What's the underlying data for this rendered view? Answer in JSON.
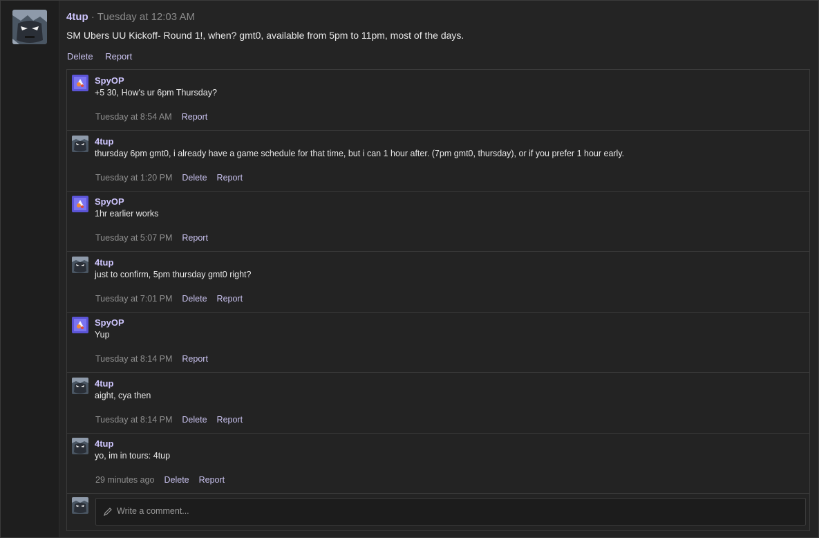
{
  "post": {
    "author": "4tup",
    "separator": "·",
    "time": "Tuesday at 12:03 AM",
    "body": "SM Ubers UU Kickoff- Round 1!, when? gmt0, available from 5pm to 11pm, most of the days.",
    "actions": {
      "delete": "Delete",
      "report": "Report"
    }
  },
  "comments": [
    {
      "author": "SpyOP",
      "text": "+5 30, How's ur 6pm Thursday?",
      "time": "Tuesday at 8:54 AM",
      "actions": [
        "Report"
      ],
      "avatar": "spyop-avatar"
    },
    {
      "author": "4tup",
      "text": "thursday 6pm gmt0, i already have a game schedule for that time, but i can 1 hour after. (7pm gmt0, thursday), or if you prefer 1 hour early.",
      "time": "Tuesday at 1:20 PM",
      "actions": [
        "Delete",
        "Report"
      ],
      "avatar": "4tup-avatar"
    },
    {
      "author": "SpyOP",
      "text": "1hr earlier works",
      "time": "Tuesday at 5:07 PM",
      "actions": [
        "Report"
      ],
      "avatar": "spyop-avatar"
    },
    {
      "author": "4tup",
      "text": "just to confirm, 5pm thursday gmt0 right?",
      "time": "Tuesday at 7:01 PM",
      "actions": [
        "Delete",
        "Report"
      ],
      "avatar": "4tup-avatar"
    },
    {
      "author": "SpyOP",
      "text": "Yup",
      "time": "Tuesday at 8:14 PM",
      "actions": [
        "Report"
      ],
      "avatar": "spyop-avatar"
    },
    {
      "author": "4tup",
      "text": "aight, cya then",
      "time": "Tuesday at 8:14 PM",
      "actions": [
        "Delete",
        "Report"
      ],
      "avatar": "4tup-avatar"
    },
    {
      "author": "4tup",
      "text": "yo, im in tours: 4tup",
      "time": "29 minutes ago",
      "actions": [
        "Delete",
        "Report"
      ],
      "avatar": "4tup-avatar"
    }
  ],
  "reply": {
    "placeholder": "Write a comment...",
    "icon": "pencil-icon"
  },
  "colors": {
    "accent": "#cfc6ff",
    "link": "#c9c2ef",
    "muted": "#8f8f8f",
    "background": "#242424"
  }
}
